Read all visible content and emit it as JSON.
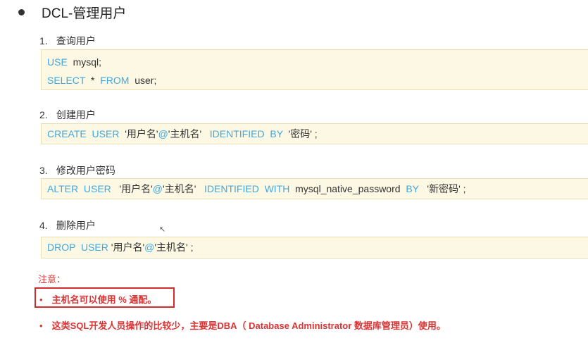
{
  "title": "DCL-管理用户",
  "steps": [
    {
      "num": "1.",
      "label": "查询用户",
      "lines": [
        [
          {
            "t": "USE",
            "kw": true
          },
          {
            "t": "  mysql;",
            "kw": false
          }
        ],
        [
          {
            "t": "SELECT",
            "kw": true
          },
          {
            "t": "  *  ",
            "kw": false
          },
          {
            "t": "FROM",
            "kw": true
          },
          {
            "t": "  user;",
            "kw": false
          }
        ]
      ]
    },
    {
      "num": "2.",
      "label": "创建用户",
      "lines": [
        [
          {
            "t": "CREATE",
            "kw": true
          },
          {
            "t": "  ",
            "kw": false
          },
          {
            "t": "USER",
            "kw": true
          },
          {
            "t": "  '用户名'",
            "kw": false
          },
          {
            "t": "@",
            "kw": true
          },
          {
            "t": "'主机名'   ",
            "kw": false
          },
          {
            "t": "IDENTIFIED",
            "kw": true
          },
          {
            "t": "  ",
            "kw": false
          },
          {
            "t": "BY",
            "kw": true
          },
          {
            "t": "  '密码' ;",
            "kw": false
          }
        ]
      ]
    },
    {
      "num": "3.",
      "label": "修改用户密码",
      "lines": [
        [
          {
            "t": "ALTER",
            "kw": true
          },
          {
            "t": "  ",
            "kw": false
          },
          {
            "t": "USER",
            "kw": true
          },
          {
            "t": "   '用户名'",
            "kw": false
          },
          {
            "t": "@",
            "kw": true
          },
          {
            "t": "'主机名'   ",
            "kw": false
          },
          {
            "t": "IDENTIFIED",
            "kw": true
          },
          {
            "t": "  ",
            "kw": false
          },
          {
            "t": "WITH",
            "kw": true
          },
          {
            "t": "  mysql_native_password  ",
            "kw": false
          },
          {
            "t": "BY",
            "kw": true
          },
          {
            "t": "   '新密码' ;",
            "kw": false
          }
        ]
      ]
    },
    {
      "num": "4.",
      "label": "删除用户",
      "lines": [
        [
          {
            "t": "DROP",
            "kw": true
          },
          {
            "t": "  ",
            "kw": false
          },
          {
            "t": "USER",
            "kw": true
          },
          {
            "t": " '用户名'",
            "kw": false
          },
          {
            "t": "@",
            "kw": true
          },
          {
            "t": "'主机名' ;",
            "kw": false
          }
        ]
      ]
    }
  ],
  "note_title": "注意：",
  "notes": [
    "主机名可以使用 % 通配。",
    "这类SQL开发人员操作的比较少，主要是DBA（ Database Administrator  数据库管理员）使用。"
  ],
  "bullet_glyph": "•",
  "cursor_glyph": "↖",
  "colors": {
    "keyword": "#3ea8e0",
    "note": "#dd3333",
    "code_bg": "#fdf8e4"
  }
}
